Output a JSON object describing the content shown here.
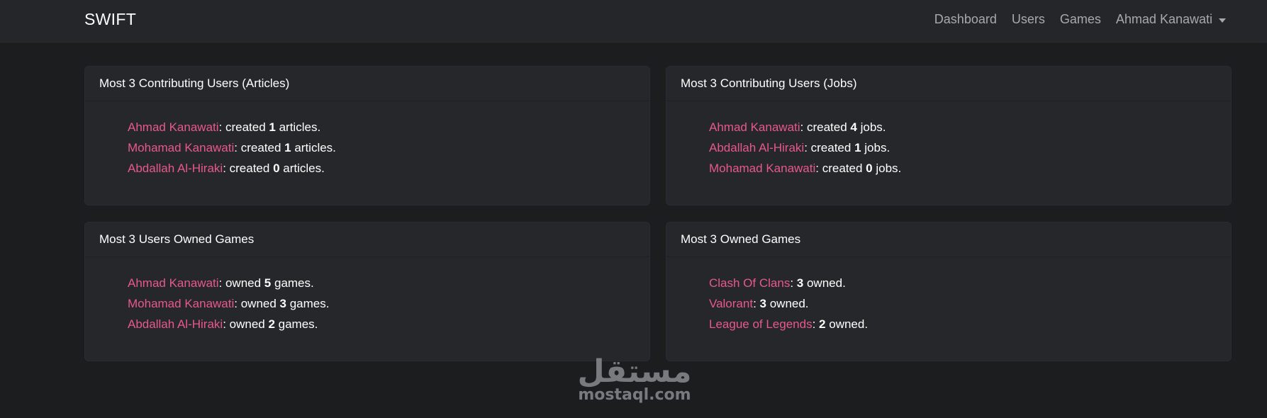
{
  "navbar": {
    "brand": "SWIFT",
    "links": [
      "Dashboard",
      "Users",
      "Games"
    ],
    "user": "Ahmad Kanawati"
  },
  "cards": {
    "articles": {
      "title": "Most 3 Contributing Users (Articles)",
      "rows": [
        {
          "name": "Ahmad Kanawati",
          "pre": ": created ",
          "count": "1",
          "post": " articles."
        },
        {
          "name": "Mohamad Kanawati",
          "pre": ": created ",
          "count": "1",
          "post": " articles."
        },
        {
          "name": "Abdallah Al-Hiraki",
          "pre": ": created ",
          "count": "0",
          "post": " articles."
        }
      ]
    },
    "jobs": {
      "title": "Most 3 Contributing Users (Jobs)",
      "rows": [
        {
          "name": "Ahmad Kanawati",
          "pre": ": created ",
          "count": "4",
          "post": " jobs."
        },
        {
          "name": "Abdallah Al-Hiraki",
          "pre": ": created ",
          "count": "1",
          "post": " jobs."
        },
        {
          "name": "Mohamad Kanawati",
          "pre": ": created ",
          "count": "0",
          "post": " jobs."
        }
      ]
    },
    "users_games": {
      "title": "Most 3 Users Owned Games",
      "rows": [
        {
          "name": "Ahmad Kanawati",
          "pre": ": owned ",
          "count": "5",
          "post": " games."
        },
        {
          "name": "Mohamad Kanawati",
          "pre": ": owned ",
          "count": "3",
          "post": " games."
        },
        {
          "name": "Abdallah Al-Hiraki",
          "pre": ": owned ",
          "count": "2",
          "post": " games."
        }
      ]
    },
    "owned_games": {
      "title": "Most 3 Owned Games",
      "rows": [
        {
          "name": "Clash Of Clans",
          "pre": ": ",
          "count": "3",
          "post": " owned."
        },
        {
          "name": "Valorant",
          "pre": ": ",
          "count": "3",
          "post": " owned."
        },
        {
          "name": "League of Legends",
          "pre": ": ",
          "count": "2",
          "post": " owned."
        }
      ]
    }
  },
  "watermark": {
    "arabic": "مستقل",
    "latin": "mostaql.com"
  },
  "colors": {
    "background": "#1c1d1f",
    "navbar": "#25262a",
    "card": "#26272a",
    "link": "#e8598a",
    "nav_text": "#a8a9ad"
  },
  "icons": {
    "user_dropdown": "caret-down-icon"
  }
}
